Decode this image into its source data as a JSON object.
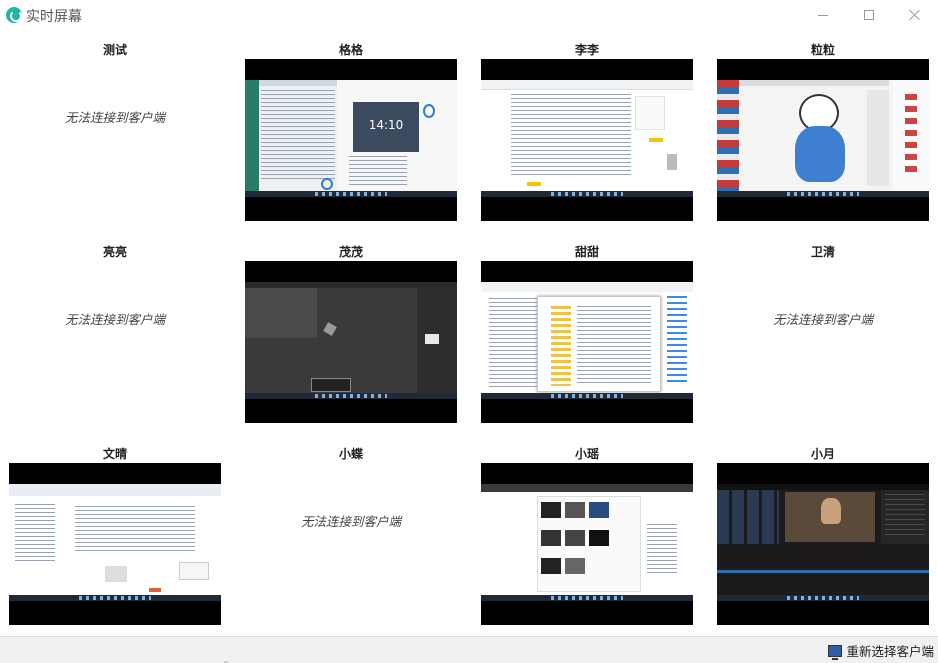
{
  "window": {
    "title": "实时屏幕",
    "app_icon": "app-logo-icon",
    "controls": [
      "minimize-icon",
      "maximize-icon",
      "close-icon"
    ]
  },
  "clients": [
    {
      "name": "测试",
      "connected": false,
      "status": "无法连接到客户端"
    },
    {
      "name": "格格",
      "connected": true,
      "clock": "14:10"
    },
    {
      "name": "李李",
      "connected": true
    },
    {
      "name": "粒粒",
      "connected": true
    },
    {
      "name": "亮亮",
      "connected": false,
      "status": "无法连接到客户端"
    },
    {
      "name": "茂茂",
      "connected": true
    },
    {
      "name": "甜甜",
      "connected": true
    },
    {
      "name": "卫清",
      "connected": false,
      "status": "无法连接到客户端"
    },
    {
      "name": "文晴",
      "connected": true
    },
    {
      "name": "小蝶",
      "connected": false,
      "status": "无法连接到客户端"
    },
    {
      "name": "小瑶",
      "connected": true
    },
    {
      "name": "小月",
      "connected": true
    }
  ],
  "footer": {
    "reselect_label": "重新选择客户端",
    "reselect_icon": "monitor-icon"
  },
  "colors": {
    "accent": "#20b5a1",
    "screen_letterbox": "#000000"
  }
}
